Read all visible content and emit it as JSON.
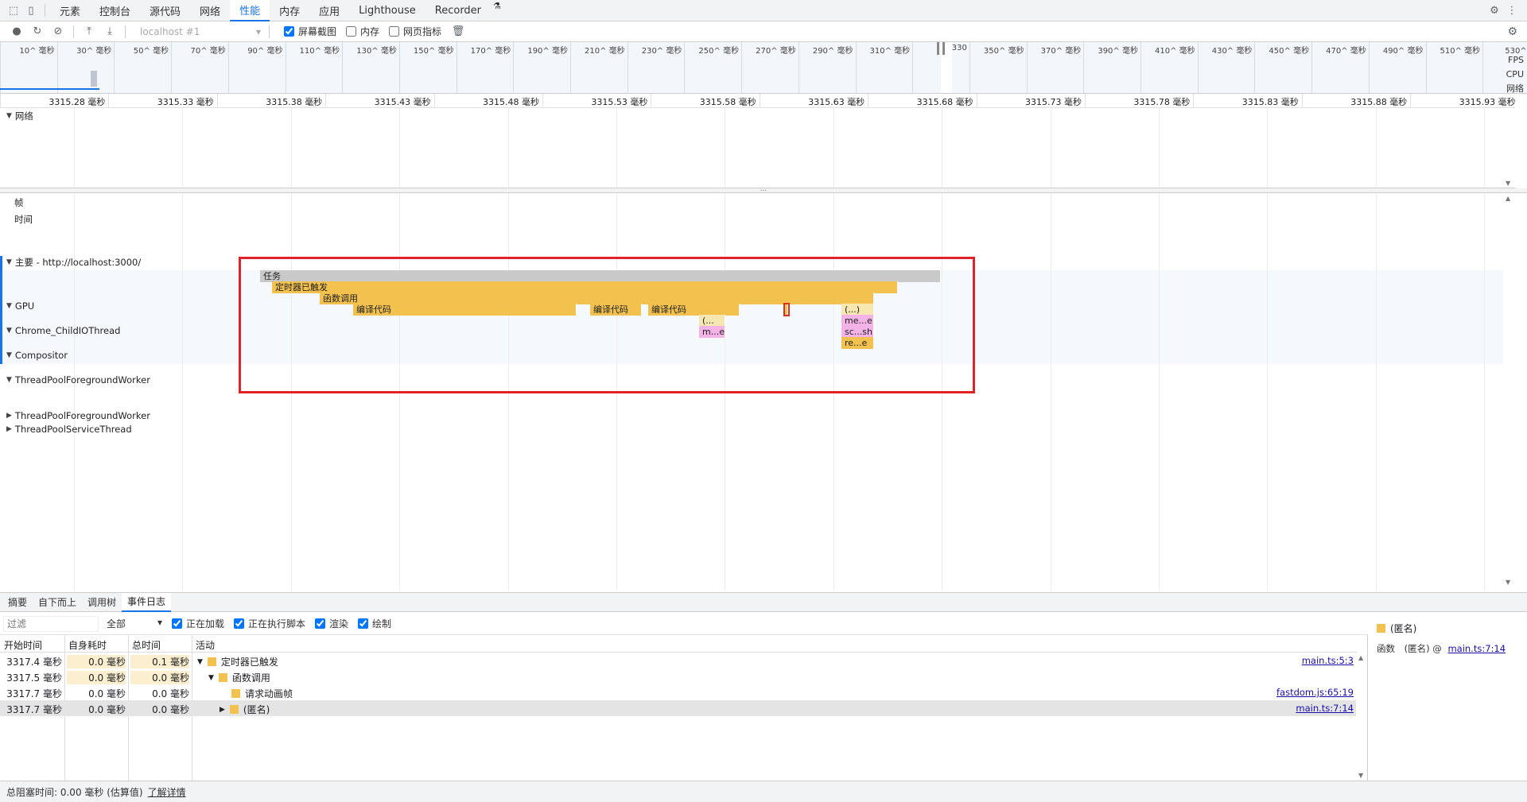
{
  "tabs": [
    "元素",
    "控制台",
    "源代码",
    "网络",
    "性能",
    "内存",
    "应用",
    "Lighthouse",
    "Recorder"
  ],
  "active_tab": "性能",
  "recorder_icon": "flask-icon",
  "toolbar": {
    "profile": "localhost #1",
    "screenshots_label": "屏幕截图",
    "screenshots_checked": true,
    "memory_label": "内存",
    "memory_checked": false,
    "webvitals_label": "网页指标",
    "webvitals_checked": false
  },
  "overview": {
    "ticks": [
      "10^ 毫秒",
      "30^ 毫秒",
      "50^ 毫秒",
      "70^ 毫秒",
      "90^ 毫秒",
      "110^ 毫秒",
      "130^ 毫秒",
      "150^ 毫秒",
      "170^ 毫秒",
      "190^ 毫秒",
      "210^ 毫秒",
      "230^ 毫秒",
      "250^ 毫秒",
      "270^ 毫秒",
      "290^ 毫秒",
      "310^ 毫秒",
      "330",
      "350^ 毫秒",
      "370^ 毫秒",
      "390^ 毫秒",
      "410^ 毫秒",
      "430^ 毫秒",
      "450^ 毫秒",
      "470^ 毫秒",
      "490^ 毫秒",
      "510^ 毫秒",
      "530^ 毫"
    ],
    "labels": [
      "FPS",
      "CPU",
      "网络"
    ]
  },
  "ruler": [
    "3315.28 毫秒",
    "3315.33 毫秒",
    "3315.38 毫秒",
    "3315.43 毫秒",
    "3315.48 毫秒",
    "3315.53 毫秒",
    "3315.58 毫秒",
    "3315.63 毫秒",
    "3315.68 毫秒",
    "3315.73 毫秒",
    "3315.78 毫秒",
    "3315.83 毫秒",
    "3315.88 毫秒",
    "3315.93 毫秒"
  ],
  "network_section": "网络",
  "tracks": {
    "frames": "帧",
    "timings": "时间",
    "main": "主要 - http://localhost:3000/",
    "gpu": "GPU",
    "child_io": "Chrome_ChildIOThread",
    "compositor": "Compositor",
    "tp_fg_1": "ThreadPoolForegroundWorker",
    "tp_fg_2": "ThreadPoolForegroundWorker",
    "tp_service": "ThreadPoolServiceThread"
  },
  "flame": {
    "task": "任务",
    "timer": "定时器已触发",
    "func": "函数调用",
    "compile1": "编译代码",
    "compile2": "编译代码",
    "compile3": "编译代码",
    "paren1": "(...",
    "me1": "m...e",
    "paren2": "(...)",
    "me2": "me...e",
    "scsh": "sc...sh",
    "ree": "re...e"
  },
  "bottom_tabs": [
    "摘要",
    "自下而上",
    "调用树",
    "事件日志"
  ],
  "bottom_active": "事件日志",
  "filter": {
    "placeholder": "过滤",
    "select": "全部",
    "loading": "正在加载",
    "scripting": "正在执行脚本",
    "rendering": "渲染",
    "painting": "绘制"
  },
  "eventlog": {
    "headers": [
      "开始时间",
      "自身耗时",
      "总时间",
      "活动"
    ],
    "rows": [
      {
        "start": "3317.4 毫秒",
        "self": "0.0 毫秒",
        "total": "0.1 毫秒",
        "activity": "定时器已触发",
        "link": "main.ts:5:3",
        "indent": 0,
        "expander": "▼"
      },
      {
        "start": "3317.5 毫秒",
        "self": "0.0 毫秒",
        "total": "0.0 毫秒",
        "activity": "函数调用",
        "link": "",
        "indent": 1,
        "expander": "▼"
      },
      {
        "start": "3317.7 毫秒",
        "self": "0.0 毫秒",
        "total": "0.0 毫秒",
        "activity": "请求动画帧",
        "link": "fastdom.js:65:19",
        "indent": 2,
        "expander": ""
      },
      {
        "start": "3317.7 毫秒",
        "self": "0.0 毫秒",
        "total": "0.0 毫秒",
        "activity": "(匿名)",
        "link": "main.ts:7:14",
        "indent": 2,
        "expander": "▶"
      }
    ]
  },
  "details": {
    "title": "(匿名)",
    "func_label": "函数",
    "func_value": "(匿名) @",
    "func_link": "main.ts:7:14"
  },
  "status": {
    "text": "总阻塞时间: 0.00 毫秒 (估算值)",
    "link": "了解详情"
  }
}
